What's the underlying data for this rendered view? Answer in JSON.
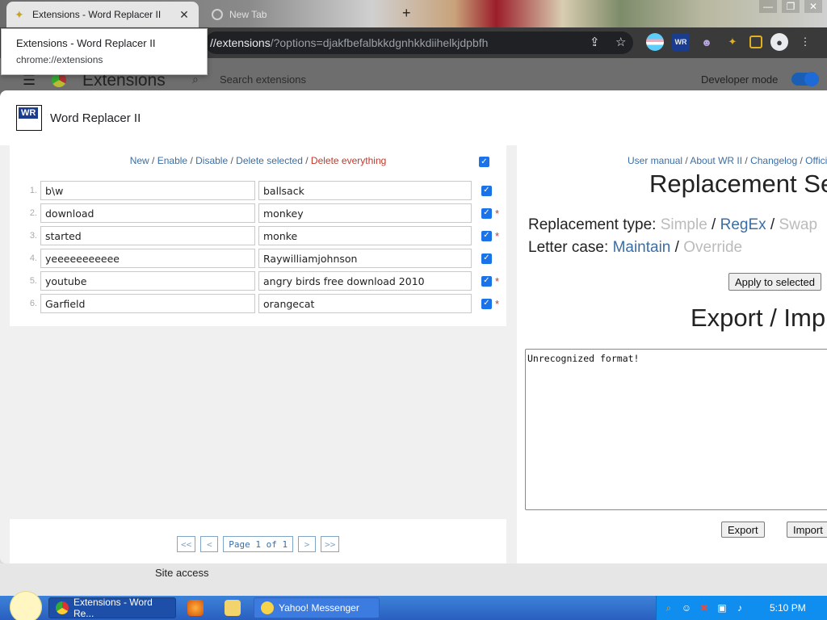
{
  "browser": {
    "active_tab": {
      "title": "Extensions - Word Replacer II",
      "close": "✕"
    },
    "inactive_tab": {
      "title": "New Tab"
    },
    "new_tab": "+",
    "window_controls": [
      "—",
      "❐",
      "✕"
    ],
    "address": {
      "host": "//extensions",
      "path": "/?options=djakfbefalbkkdgnhkkdiihelkjdpbfh"
    },
    "tooltip": {
      "title": "Extensions - Word Replacer II",
      "url": "chrome://extensions"
    },
    "toolbar_icons": [
      "share-icon",
      "star-icon",
      "ext-flag-icon",
      "word-replacer-icon",
      "ext-cat-icon",
      "puzzle-icon",
      "sidepanel-icon",
      "profile-icon",
      "menu-icon"
    ]
  },
  "extensions_page": {
    "title": "Extensions",
    "search_placeholder": "Search extensions",
    "developer_mode_label": "Developer mode",
    "developer_mode_on": true,
    "site_access_label": "Site access"
  },
  "modal": {
    "title": "Word Replacer II",
    "logo_text": "WR",
    "actions": {
      "new": "New",
      "enable": "Enable",
      "disable": "Disable",
      "delete_selected": "Delete selected",
      "delete_everything": "Delete everything",
      "sep": " / "
    },
    "rows": [
      {
        "num": "1.",
        "find": "b\\w",
        "replace": "ballsack",
        "checked": true,
        "asterisk": ""
      },
      {
        "num": "2.",
        "find": "download",
        "replace": "monkey",
        "checked": true,
        "asterisk": "*"
      },
      {
        "num": "3.",
        "find": "started",
        "replace": "monke",
        "checked": true,
        "asterisk": "*"
      },
      {
        "num": "4.",
        "find": "yeeeeeeeeeee",
        "replace": "Raywilliamjohnson",
        "checked": true,
        "asterisk": ""
      },
      {
        "num": "5.",
        "find": "youtube",
        "replace": "angry birds free download 2010",
        "checked": true,
        "asterisk": "*"
      },
      {
        "num": "6.",
        "find": "Garfield",
        "replace": "orangecat",
        "checked": true,
        "asterisk": "*"
      }
    ],
    "pager": {
      "first": "<<",
      "prev": "<",
      "info": "Page 1 of 1",
      "next": ">",
      "last": ">>"
    },
    "links": {
      "manual": "User manual",
      "about": "About WR II",
      "changelog": "Changelog",
      "official": "Offici"
    },
    "replacement_settings_title": "Replacement Se",
    "replacement_type": {
      "label": "Replacement type: ",
      "simple": "Simple",
      "regex": "RegEx",
      "swap": "Swap"
    },
    "letter_case": {
      "label": "Letter case: ",
      "maintain": "Maintain",
      "override": "Override"
    },
    "apply_button": "Apply to selected",
    "export_import_title": "Export / Imp",
    "textarea_value": "Unrecognized format!",
    "export_button": "Export",
    "import_button": "Import"
  },
  "taskbar": {
    "buttons": [
      {
        "label": "Extensions - Word Re...",
        "active": true
      },
      {
        "label": "Yahoo! Messenger",
        "active": false
      }
    ],
    "tray_icons": [
      "search-tray-icon",
      "smiley-tray-icon",
      "network-x-icon",
      "network-icon",
      "volume-icon"
    ],
    "clock": "5:10 PM"
  },
  "colors": {
    "accent_link": "#3a6ea5",
    "danger": "#c0392b",
    "checkbox": "#1a73e8",
    "taskbar": "#2a5fc0"
  }
}
